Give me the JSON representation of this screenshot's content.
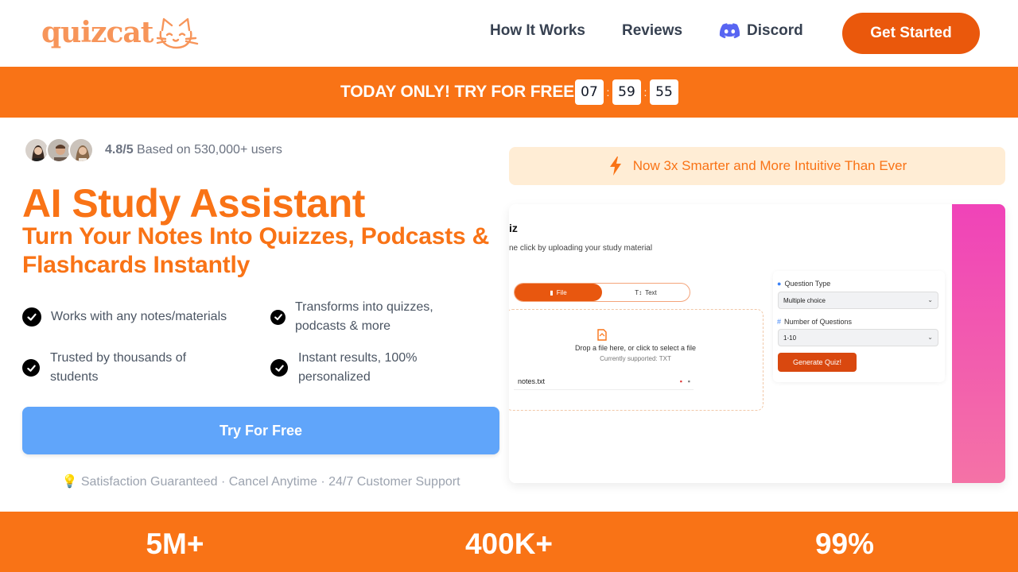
{
  "brand": {
    "name": "quizcat",
    "logo_color": "#f7955a",
    "accent": "#ea580c",
    "banner": "#f97316"
  },
  "nav": {
    "how_it_works": "How It Works",
    "reviews": "Reviews",
    "discord": "Discord",
    "get_started": "Get Started"
  },
  "promo": {
    "text": "TODAY ONLY! TRY FOR FREE",
    "timer": {
      "hours": "07",
      "minutes": "59",
      "seconds": "55",
      "sep": ":"
    }
  },
  "hero": {
    "rating_score": "4.8/5",
    "rating_text": "Based on 530,000+ users",
    "title": "AI Study Assistant",
    "subtitle": "Turn Your Notes Into Quizzes, Podcasts & Flashcards Instantly",
    "features": [
      "Works with any notes/materials",
      "Transforms into quizzes, podcasts & more",
      "Trusted by thousands of students",
      "Instant results, 100% personalized"
    ],
    "cta": "Try For Free",
    "guarantee": "💡 Satisfaction Guaranteed · Cancel Anytime · 24/7 Customer Support"
  },
  "announcement": {
    "text": "Now 3x Smarter and More Intuitive Than Ever",
    "icon": "lightning-icon"
  },
  "demo": {
    "title": "iz",
    "subtitle": "ne click by uploading your study material",
    "tab_file": "File",
    "tab_text": "Text",
    "drop_main": "Drop a file here, or click to select a file",
    "drop_sub": "Currently supported: TXT",
    "file_name": "notes.txt",
    "question_type_label": "Question Type",
    "question_type_value": "Multiple choice",
    "num_questions_label": "Number of Questions",
    "num_questions_value": "1-10",
    "generate": "Generate Quiz!"
  },
  "stats": [
    {
      "value": "5M+"
    },
    {
      "value": "400K+"
    },
    {
      "value": "99%"
    }
  ]
}
